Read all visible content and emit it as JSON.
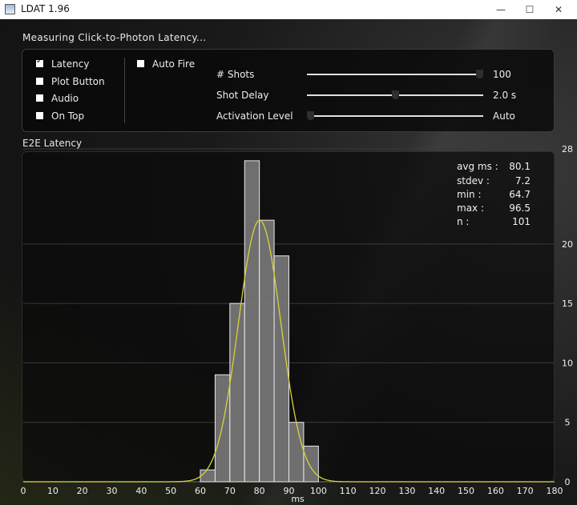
{
  "window": {
    "title": "LDAT 1.96",
    "minimize_glyph": "—",
    "maximize_glyph": "☐",
    "close_glyph": "✕",
    "icon": "ldat-app-icon"
  },
  "header": {
    "measuring_label": "Measuring Click-to-Photon Latency..."
  },
  "options": {
    "checkboxes": [
      {
        "key": "latency",
        "label": "Latency",
        "checked": true
      },
      {
        "key": "plot_button",
        "label": "Plot Button",
        "checked": false
      },
      {
        "key": "audio",
        "label": "Audio",
        "checked": false
      },
      {
        "key": "on_top",
        "label": "On Top",
        "checked": false
      },
      {
        "key": "auto_fire",
        "label": "Auto Fire",
        "checked": false
      }
    ],
    "sliders": [
      {
        "key": "shots",
        "label": "# Shots",
        "value": "100",
        "fraction": 1.0
      },
      {
        "key": "shot_delay",
        "label": "Shot Delay",
        "value": "2.0  s",
        "fraction": 0.5
      },
      {
        "key": "activation_level",
        "label": "Activation Level",
        "value": "Auto",
        "fraction": 0.0
      }
    ]
  },
  "plot": {
    "section_label": "E2E  Latency",
    "stats": [
      {
        "label": "avg  ms  :",
        "value": "80.1"
      },
      {
        "label": "stdev  :",
        "value": "7.2"
      },
      {
        "label": "min  :",
        "value": "64.7"
      },
      {
        "label": "max  :",
        "value": "96.5"
      },
      {
        "label": "n  :",
        "value": "101"
      }
    ]
  },
  "chart_data": {
    "type": "bar",
    "title": "E2E  Latency",
    "xlabel": "ms",
    "ylabel": "",
    "xlim": [
      0,
      180
    ],
    "ylim": [
      0,
      28
    ],
    "x_ticks": [
      0,
      10,
      20,
      30,
      40,
      50,
      60,
      70,
      80,
      90,
      100,
      110,
      120,
      130,
      140,
      150,
      160,
      170,
      180
    ],
    "y_ticks": [
      0,
      5,
      10,
      15,
      20,
      28
    ],
    "bin_width": 5,
    "bins": [
      {
        "start": 60,
        "count": 1
      },
      {
        "start": 65,
        "count": 9
      },
      {
        "start": 70,
        "count": 15
      },
      {
        "start": 75,
        "count": 27
      },
      {
        "start": 80,
        "count": 22
      },
      {
        "start": 85,
        "count": 19
      },
      {
        "start": 90,
        "count": 5
      },
      {
        "start": 95,
        "count": 3
      }
    ],
    "fit_curve": {
      "type": "normal",
      "mean": 80.1,
      "stdev": 7.2,
      "peak": 22
    },
    "grid": true,
    "colors": {
      "bar_fill": "#7a7a7a",
      "bar_edge": "#e8e8e8",
      "curve": "#d8d23a",
      "grid": "#3a3a3a"
    }
  }
}
